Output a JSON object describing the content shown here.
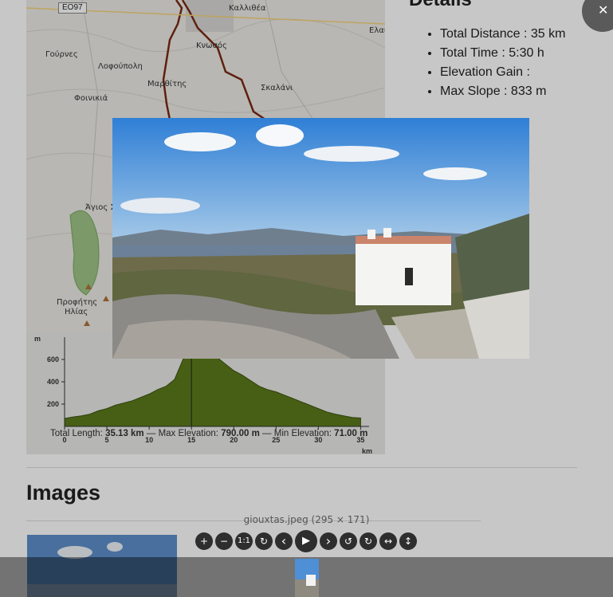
{
  "map": {
    "road_shield": "ΕΟ97",
    "labels": [
      {
        "name": "map-label-kallithea",
        "text": "Καλλιθέα"
      },
      {
        "name": "map-label-elaia",
        "text": "Ελαι"
      },
      {
        "name": "map-label-gournes",
        "text": "Γούρνες"
      },
      {
        "name": "map-label-knossos",
        "text": "Κνωσός"
      },
      {
        "name": "map-label-lofopoli",
        "text": "Λοφούπολη"
      },
      {
        "name": "map-label-marathitis",
        "text": "Μαρθίτης"
      },
      {
        "name": "map-label-skalani",
        "text": "Σκαλάνι"
      },
      {
        "name": "map-label-foinikia",
        "text": "Φοινικιά"
      },
      {
        "name": "map-label-agios",
        "text": "Άγιος Σ"
      },
      {
        "name": "map-label-profitis",
        "text": "Προφήτης"
      },
      {
        "name": "map-label-ilias",
        "text": "Ηλίας"
      }
    ]
  },
  "profile": {
    "y_unit": "m",
    "x_unit": "km",
    "summary": {
      "distance_label": "Total Length:",
      "distance_value": "35.13 km",
      "sep1": "—",
      "max_label": "Max Elevation:",
      "max_value": "790.00 m",
      "sep2": "—",
      "min_label": "Min Elevation:",
      "min_value": "71.00 m"
    }
  },
  "chart_data": {
    "type": "area",
    "title": "",
    "xlabel": "km",
    "ylabel": "m",
    "xlim": [
      0,
      36
    ],
    "ylim": [
      0,
      800
    ],
    "x_ticks": [
      0,
      5,
      10,
      15,
      20,
      25,
      30,
      35
    ],
    "y_ticks": [
      200,
      400,
      600
    ],
    "series": [
      {
        "x": [
          0,
          1,
          2,
          3,
          4,
          5,
          6,
          7,
          8,
          9,
          10,
          11,
          12,
          13,
          14,
          15,
          16,
          17,
          18,
          19,
          20,
          21,
          22,
          23,
          24,
          25,
          26,
          27,
          28,
          29,
          30,
          31,
          32,
          33,
          34,
          35
        ],
        "y": [
          71,
          85,
          95,
          110,
          140,
          160,
          190,
          210,
          230,
          260,
          290,
          330,
          360,
          420,
          600,
          790,
          780,
          700,
          620,
          560,
          500,
          460,
          410,
          360,
          330,
          310,
          280,
          250,
          220,
          190,
          160,
          130,
          110,
          95,
          80,
          75
        ]
      }
    ]
  },
  "details": {
    "title": "Details",
    "items": [
      "Total Distance : 35 km",
      "Total Time : 5:30 h",
      "Elevation Gain :",
      "Max Slope : 833 m"
    ]
  },
  "images": {
    "title": "Images"
  },
  "lightbox": {
    "caption": "giouxtas.jpeg (295 × 171)",
    "toolbar": [
      {
        "name": "zoom-in-button",
        "icon": "plus-icon",
        "glyph": "+"
      },
      {
        "name": "zoom-out-button",
        "icon": "minus-icon",
        "glyph": "−"
      },
      {
        "name": "one-to-one-button",
        "icon": "one-to-one-icon",
        "glyph": "1:1"
      },
      {
        "name": "reset-button",
        "icon": "reset-icon",
        "glyph": "↻"
      },
      {
        "name": "prev-button",
        "icon": "chevron-left-icon",
        "glyph": "‹"
      },
      {
        "name": "play-button",
        "icon": "play-icon",
        "glyph": "▶"
      },
      {
        "name": "next-button",
        "icon": "chevron-right-icon",
        "glyph": "›"
      },
      {
        "name": "rotate-left-button",
        "icon": "rotate-left-icon",
        "glyph": "↺"
      },
      {
        "name": "rotate-right-button",
        "icon": "rotate-right-icon",
        "glyph": "↻"
      },
      {
        "name": "flip-horizontal-button",
        "icon": "flip-horizontal-icon",
        "glyph": "↔"
      },
      {
        "name": "flip-vertical-button",
        "icon": "flip-vertical-icon",
        "glyph": "↕"
      }
    ],
    "close_glyph": "✕"
  },
  "colors": {
    "profile_fill": "#5b7a1a",
    "route": "#7a2a14",
    "sky": "#4f8fd6"
  }
}
